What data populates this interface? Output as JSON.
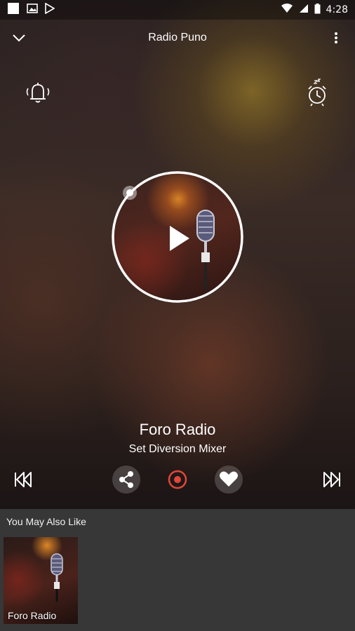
{
  "status_bar": {
    "time": "4:28"
  },
  "header": {
    "title": "Radio Puno"
  },
  "now_playing": {
    "station": "Foro Radio",
    "program": "Set Diversion Mixer"
  },
  "recommendations": {
    "heading": "You May Also Like",
    "items": [
      {
        "name": "Foro Radio"
      }
    ]
  },
  "icons": {
    "back": "chevron-down-icon",
    "menu": "more-vert-icon",
    "alarm": "bell-icon",
    "sleep": "sleep-timer-icon",
    "play": "play-icon",
    "rewind": "rewind-icon",
    "share": "share-icon",
    "record": "record-icon",
    "favorite": "heart-icon",
    "forward": "fast-forward-icon"
  },
  "colors": {
    "accent": "#e2473a",
    "section_bg": "#373737"
  }
}
